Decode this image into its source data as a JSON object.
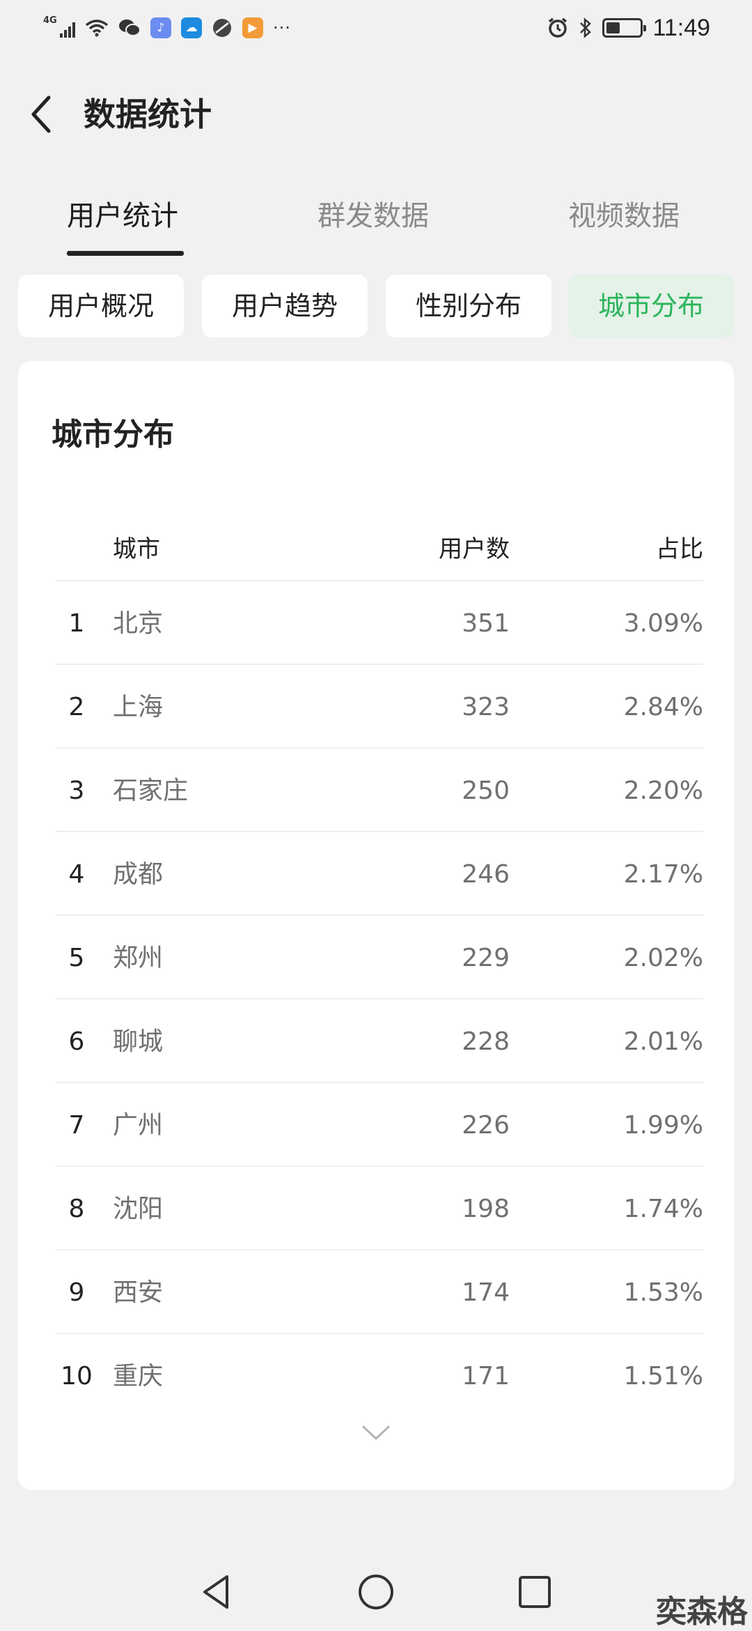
{
  "status_bar": {
    "network": "4G",
    "time": "11:49",
    "more": "···",
    "icons": [
      "signal-icon",
      "wifi-icon",
      "wechat-icon",
      "music-icon",
      "weather-icon",
      "browser-icon",
      "video-icon",
      "alarm-icon",
      "bluetooth-icon",
      "battery-icon"
    ]
  },
  "header": {
    "title": "数据统计"
  },
  "main_tabs": [
    {
      "label": "用户统计",
      "active": true
    },
    {
      "label": "群发数据",
      "active": false
    },
    {
      "label": "视频数据",
      "active": false
    }
  ],
  "sub_tabs": [
    {
      "label": "用户概况",
      "active": false
    },
    {
      "label": "用户趋势",
      "active": false
    },
    {
      "label": "性别分布",
      "active": false
    },
    {
      "label": "城市分布",
      "active": true
    }
  ],
  "colors": {
    "accent": "#2bb45c",
    "accent_bg": "#e4f2e8",
    "page_bg": "#f1f1f1"
  },
  "card": {
    "title": "城市分布",
    "columns": {
      "city": "城市",
      "users": "用户数",
      "share": "占比"
    },
    "rows": [
      {
        "rank": "1",
        "city": "北京",
        "users": "351",
        "share": "3.09%"
      },
      {
        "rank": "2",
        "city": "上海",
        "users": "323",
        "share": "2.84%"
      },
      {
        "rank": "3",
        "city": "石家庄",
        "users": "250",
        "share": "2.20%"
      },
      {
        "rank": "4",
        "city": "成都",
        "users": "246",
        "share": "2.17%"
      },
      {
        "rank": "5",
        "city": "郑州",
        "users": "229",
        "share": "2.02%"
      },
      {
        "rank": "6",
        "city": "聊城",
        "users": "228",
        "share": "2.01%"
      },
      {
        "rank": "7",
        "city": "广州",
        "users": "226",
        "share": "1.99%"
      },
      {
        "rank": "8",
        "city": "沈阳",
        "users": "198",
        "share": "1.74%"
      },
      {
        "rank": "9",
        "city": "西安",
        "users": "174",
        "share": "1.53%"
      },
      {
        "rank": "10",
        "city": "重庆",
        "users": "171",
        "share": "1.51%"
      }
    ]
  },
  "watermark": "奕森格"
}
